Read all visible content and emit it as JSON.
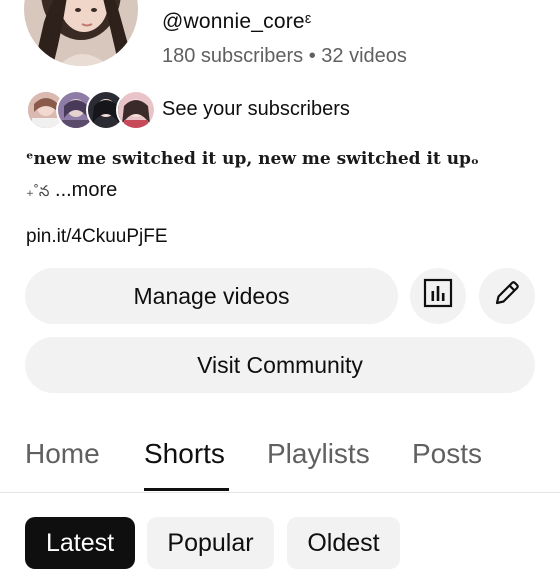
{
  "channel": {
    "handle": "@wonnie_coreᵋ",
    "stats": "180 subscribers • 32 videos",
    "subscribers_label": "See your subscribers",
    "description_line1": "ᵉnew me switched it up, new me switched it upₒ",
    "description_line2_decor": "₊˚న",
    "description_more": "...more",
    "link": "pin.it/4CkuuPjFE"
  },
  "actions": {
    "manage_label": "Manage videos",
    "analytics_icon": "bar-chart-icon",
    "edit_icon": "pencil-icon",
    "community_label": "Visit Community"
  },
  "tabs": [
    {
      "label": "Home",
      "active": false
    },
    {
      "label": "Shorts",
      "active": true
    },
    {
      "label": "Playlists",
      "active": false
    },
    {
      "label": "Posts",
      "active": false
    }
  ],
  "chips": [
    {
      "label": "Latest",
      "active": true
    },
    {
      "label": "Popular",
      "active": false
    },
    {
      "label": "Oldest",
      "active": false
    }
  ],
  "colors": {
    "text": "#0f0f0f",
    "secondary": "#606060",
    "button_bg": "#f2f2f2",
    "active_chip_bg": "#0f0f0f"
  }
}
